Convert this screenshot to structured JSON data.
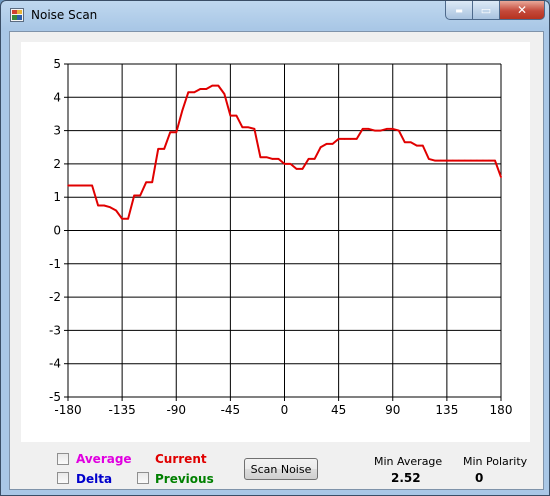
{
  "window": {
    "title": "Noise Scan",
    "min_glyph": "▬",
    "max_glyph": "▭",
    "close_glyph": "✕",
    "icon": "app-icon"
  },
  "legend": {
    "average": {
      "label": "Average",
      "color": "#e000e0"
    },
    "delta": {
      "label": "Delta",
      "color": "#0000cc"
    },
    "current": {
      "label": "Current",
      "color": "#e00000"
    },
    "previous": {
      "label": "Previous",
      "color": "#008000"
    }
  },
  "scan_button": "Scan Noise",
  "stats": {
    "min_average_label": "Min Average",
    "min_average_value": "2.52",
    "min_polarity_label": "Min Polarity",
    "min_polarity_value": "0"
  },
  "chart_data": {
    "type": "line",
    "title": "",
    "xlabel": "",
    "ylabel": "",
    "xlim": [
      -180,
      180
    ],
    "ylim": [
      -5,
      5
    ],
    "xticks": [
      -180,
      -135,
      -90,
      -45,
      0,
      45,
      90,
      135,
      180
    ],
    "yticks": [
      5,
      4,
      3,
      2,
      1,
      0,
      -1,
      -2,
      -3,
      -4,
      -5
    ],
    "grid": true,
    "series": [
      {
        "color": "#e00000",
        "x": [
          -180,
          -160,
          -155,
          -150,
          -145,
          -140,
          -135,
          -130,
          -125,
          -120,
          -115,
          -110,
          -105,
          -100,
          -95,
          -90,
          -85,
          -80,
          -75,
          -70,
          -65,
          -60,
          -55,
          -50,
          -45,
          -40,
          -35,
          -30,
          -25,
          -20,
          -15,
          -10,
          -5,
          0,
          5,
          10,
          15,
          20,
          25,
          30,
          35,
          40,
          45,
          50,
          55,
          60,
          65,
          70,
          75,
          80,
          85,
          90,
          95,
          100,
          105,
          110,
          115,
          120,
          125,
          130,
          135,
          140,
          145,
          150,
          155,
          160,
          165,
          170,
          175,
          180
        ],
        "y": [
          1.35,
          1.35,
          0.75,
          0.75,
          0.7,
          0.6,
          0.35,
          0.35,
          1.05,
          1.05,
          1.45,
          1.45,
          2.45,
          2.45,
          2.95,
          2.95,
          3.6,
          4.15,
          4.15,
          4.25,
          4.25,
          4.35,
          4.35,
          4.1,
          3.45,
          3.45,
          3.1,
          3.1,
          3.05,
          2.2,
          2.2,
          2.15,
          2.15,
          2.0,
          2.0,
          1.85,
          1.85,
          2.15,
          2.15,
          2.5,
          2.6,
          2.6,
          2.75,
          2.75,
          2.75,
          2.75,
          3.05,
          3.05,
          3.0,
          3.0,
          3.05,
          3.05,
          3.0,
          2.65,
          2.65,
          2.55,
          2.55,
          2.15,
          2.1,
          2.1,
          2.1,
          2.1,
          2.1,
          2.1,
          2.1,
          2.1,
          2.1,
          2.1,
          2.1,
          1.6
        ]
      }
    ]
  }
}
